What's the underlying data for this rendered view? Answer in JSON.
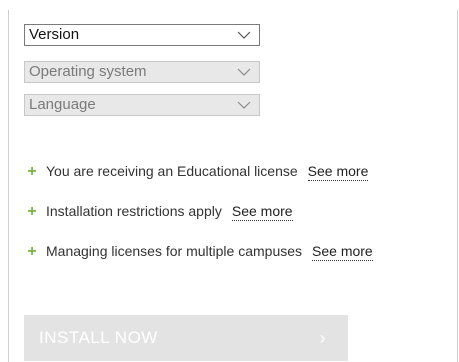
{
  "selects": {
    "version": {
      "label": "Version",
      "disabled": false
    },
    "os": {
      "label": "Operating system",
      "disabled": true
    },
    "language": {
      "label": "Language",
      "disabled": true
    }
  },
  "info": [
    {
      "icon": "plus-icon",
      "text": "You are receiving an Educational license",
      "link": "See more"
    },
    {
      "icon": "plus-icon",
      "text": "Installation restrictions apply",
      "link": "See more"
    },
    {
      "icon": "plus-icon",
      "text": "Managing licenses for multiple campuses",
      "link": "See more"
    }
  ],
  "plus_symbol": "+",
  "install": {
    "label": "INSTALL NOW",
    "arrow": "›",
    "disabled": true
  },
  "colors": {
    "accent_plus": "#7cb342",
    "button_disabled_bg": "#e3e3e3"
  }
}
